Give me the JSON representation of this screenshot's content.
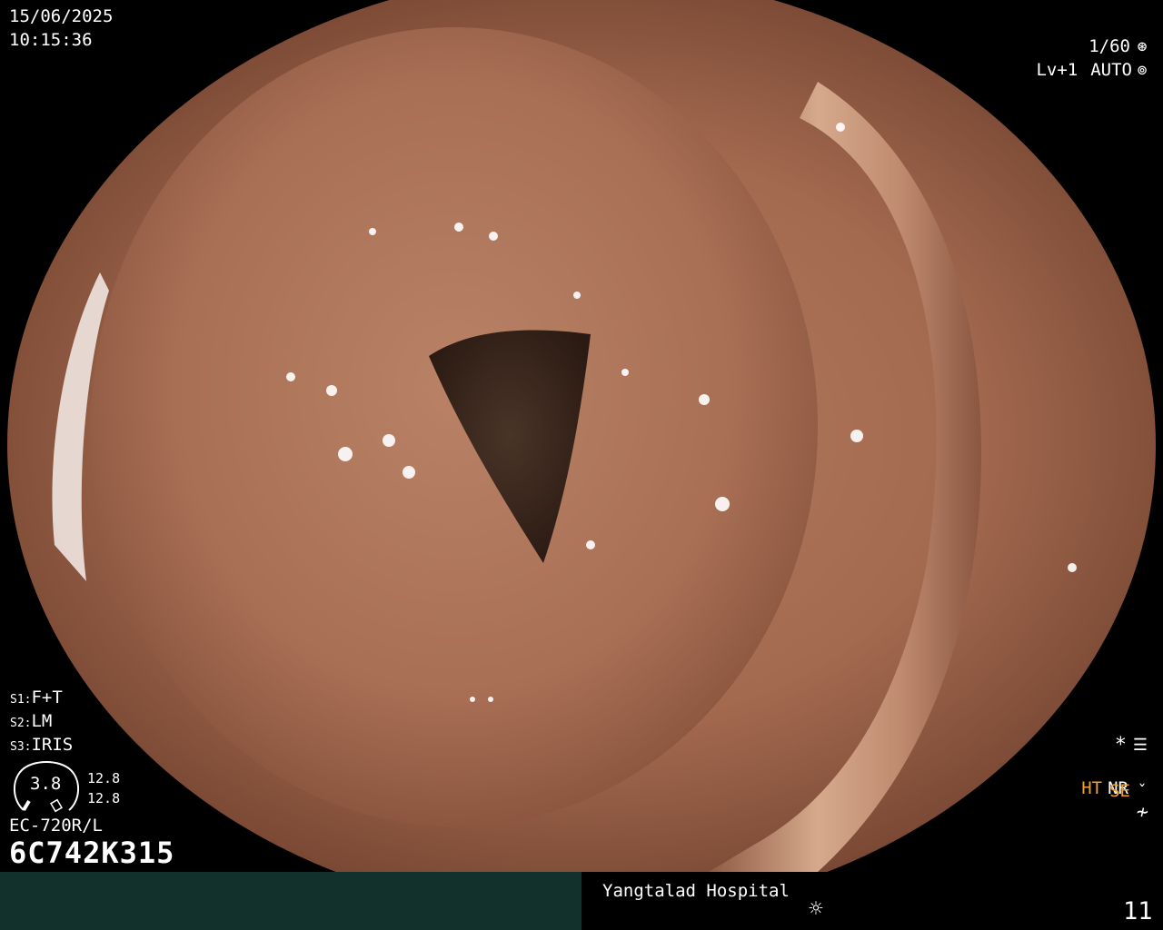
{
  "header": {
    "date": "15/06/2025",
    "time": "10:15:36"
  },
  "status": {
    "shutter": "1/60",
    "shutter_icon": "aperture-icon",
    "level": "Lv+1",
    "exposure": "AUTO",
    "exposure_icon": "iris-icon"
  },
  "settings": {
    "s1": {
      "prefix": "S1:",
      "value": "F+T"
    },
    "s2": {
      "prefix": "S2:",
      "value": "LM"
    },
    "s3": {
      "prefix": "S3:",
      "value": "IRIS"
    }
  },
  "scope": {
    "zoom": "3.8",
    "readout_top": "12.8",
    "readout_bottom": "12.8",
    "model": "EC-720R/L",
    "serial": "6C742K315"
  },
  "indicators": {
    "star": "*",
    "menu_icon": "settings-list-icon",
    "ht": "HT",
    "nr": "NR",
    "se": "SE",
    "se_icon": "curve-icon",
    "extra": "≁"
  },
  "footer": {
    "hospital": "Yangtalad Hospital",
    "light_icon": "light-icon",
    "count": "11"
  },
  "colors": {
    "accent": "#f0a030",
    "footer_bar": "#12302c"
  }
}
